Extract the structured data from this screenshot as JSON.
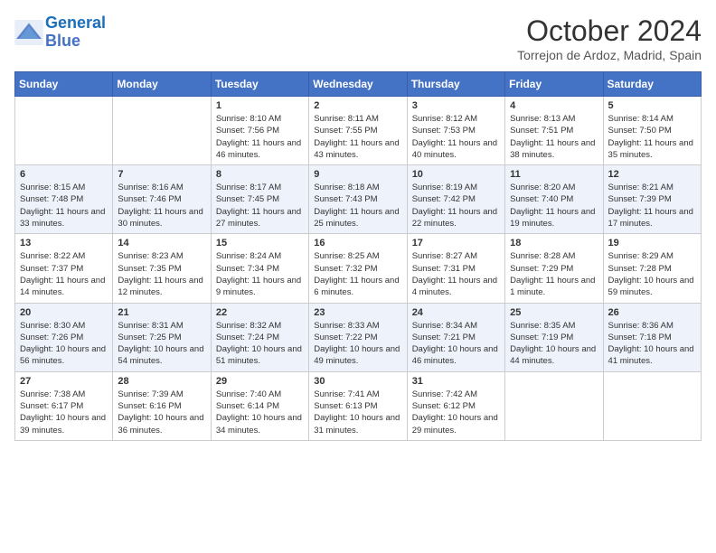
{
  "header": {
    "logo_line1": "General",
    "logo_line2": "Blue",
    "month": "October 2024",
    "location": "Torrejon de Ardoz, Madrid, Spain"
  },
  "days_of_week": [
    "Sunday",
    "Monday",
    "Tuesday",
    "Wednesday",
    "Thursday",
    "Friday",
    "Saturday"
  ],
  "weeks": [
    [
      {
        "day": "",
        "info": ""
      },
      {
        "day": "",
        "info": ""
      },
      {
        "day": "1",
        "info": "Sunrise: 8:10 AM\nSunset: 7:56 PM\nDaylight: 11 hours and 46 minutes."
      },
      {
        "day": "2",
        "info": "Sunrise: 8:11 AM\nSunset: 7:55 PM\nDaylight: 11 hours and 43 minutes."
      },
      {
        "day": "3",
        "info": "Sunrise: 8:12 AM\nSunset: 7:53 PM\nDaylight: 11 hours and 40 minutes."
      },
      {
        "day": "4",
        "info": "Sunrise: 8:13 AM\nSunset: 7:51 PM\nDaylight: 11 hours and 38 minutes."
      },
      {
        "day": "5",
        "info": "Sunrise: 8:14 AM\nSunset: 7:50 PM\nDaylight: 11 hours and 35 minutes."
      }
    ],
    [
      {
        "day": "6",
        "info": "Sunrise: 8:15 AM\nSunset: 7:48 PM\nDaylight: 11 hours and 33 minutes."
      },
      {
        "day": "7",
        "info": "Sunrise: 8:16 AM\nSunset: 7:46 PM\nDaylight: 11 hours and 30 minutes."
      },
      {
        "day": "8",
        "info": "Sunrise: 8:17 AM\nSunset: 7:45 PM\nDaylight: 11 hours and 27 minutes."
      },
      {
        "day": "9",
        "info": "Sunrise: 8:18 AM\nSunset: 7:43 PM\nDaylight: 11 hours and 25 minutes."
      },
      {
        "day": "10",
        "info": "Sunrise: 8:19 AM\nSunset: 7:42 PM\nDaylight: 11 hours and 22 minutes."
      },
      {
        "day": "11",
        "info": "Sunrise: 8:20 AM\nSunset: 7:40 PM\nDaylight: 11 hours and 19 minutes."
      },
      {
        "day": "12",
        "info": "Sunrise: 8:21 AM\nSunset: 7:39 PM\nDaylight: 11 hours and 17 minutes."
      }
    ],
    [
      {
        "day": "13",
        "info": "Sunrise: 8:22 AM\nSunset: 7:37 PM\nDaylight: 11 hours and 14 minutes."
      },
      {
        "day": "14",
        "info": "Sunrise: 8:23 AM\nSunset: 7:35 PM\nDaylight: 11 hours and 12 minutes."
      },
      {
        "day": "15",
        "info": "Sunrise: 8:24 AM\nSunset: 7:34 PM\nDaylight: 11 hours and 9 minutes."
      },
      {
        "day": "16",
        "info": "Sunrise: 8:25 AM\nSunset: 7:32 PM\nDaylight: 11 hours and 6 minutes."
      },
      {
        "day": "17",
        "info": "Sunrise: 8:27 AM\nSunset: 7:31 PM\nDaylight: 11 hours and 4 minutes."
      },
      {
        "day": "18",
        "info": "Sunrise: 8:28 AM\nSunset: 7:29 PM\nDaylight: 11 hours and 1 minute."
      },
      {
        "day": "19",
        "info": "Sunrise: 8:29 AM\nSunset: 7:28 PM\nDaylight: 10 hours and 59 minutes."
      }
    ],
    [
      {
        "day": "20",
        "info": "Sunrise: 8:30 AM\nSunset: 7:26 PM\nDaylight: 10 hours and 56 minutes."
      },
      {
        "day": "21",
        "info": "Sunrise: 8:31 AM\nSunset: 7:25 PM\nDaylight: 10 hours and 54 minutes."
      },
      {
        "day": "22",
        "info": "Sunrise: 8:32 AM\nSunset: 7:24 PM\nDaylight: 10 hours and 51 minutes."
      },
      {
        "day": "23",
        "info": "Sunrise: 8:33 AM\nSunset: 7:22 PM\nDaylight: 10 hours and 49 minutes."
      },
      {
        "day": "24",
        "info": "Sunrise: 8:34 AM\nSunset: 7:21 PM\nDaylight: 10 hours and 46 minutes."
      },
      {
        "day": "25",
        "info": "Sunrise: 8:35 AM\nSunset: 7:19 PM\nDaylight: 10 hours and 44 minutes."
      },
      {
        "day": "26",
        "info": "Sunrise: 8:36 AM\nSunset: 7:18 PM\nDaylight: 10 hours and 41 minutes."
      }
    ],
    [
      {
        "day": "27",
        "info": "Sunrise: 7:38 AM\nSunset: 6:17 PM\nDaylight: 10 hours and 39 minutes."
      },
      {
        "day": "28",
        "info": "Sunrise: 7:39 AM\nSunset: 6:16 PM\nDaylight: 10 hours and 36 minutes."
      },
      {
        "day": "29",
        "info": "Sunrise: 7:40 AM\nSunset: 6:14 PM\nDaylight: 10 hours and 34 minutes."
      },
      {
        "day": "30",
        "info": "Sunrise: 7:41 AM\nSunset: 6:13 PM\nDaylight: 10 hours and 31 minutes."
      },
      {
        "day": "31",
        "info": "Sunrise: 7:42 AM\nSunset: 6:12 PM\nDaylight: 10 hours and 29 minutes."
      },
      {
        "day": "",
        "info": ""
      },
      {
        "day": "",
        "info": ""
      }
    ]
  ]
}
